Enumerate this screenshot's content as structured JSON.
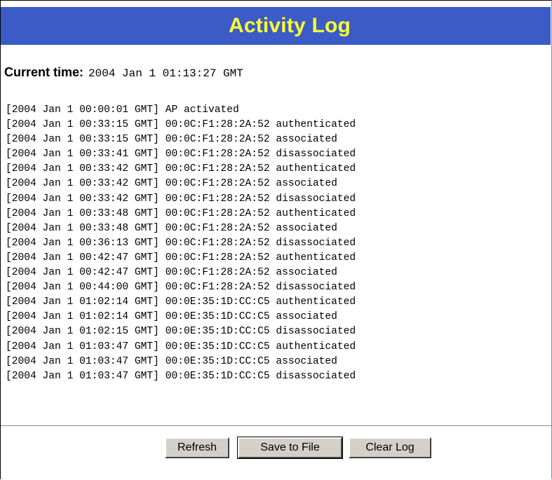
{
  "header": {
    "title": "Activity Log"
  },
  "current_time": {
    "label": "Current time:",
    "value": "2004 Jan 1 01:13:27 GMT"
  },
  "log": [
    "[2004 Jan 1 00:00:01 GMT] AP activated",
    "[2004 Jan 1 00:33:15 GMT] 00:0C:F1:28:2A:52 authenticated",
    "[2004 Jan 1 00:33:15 GMT] 00:0C:F1:28:2A:52 associated",
    "[2004 Jan 1 00:33:41 GMT] 00:0C:F1:28:2A:52 disassociated",
    "[2004 Jan 1 00:33:42 GMT] 00:0C:F1:28:2A:52 authenticated",
    "[2004 Jan 1 00:33:42 GMT] 00:0C:F1:28:2A:52 associated",
    "[2004 Jan 1 00:33:42 GMT] 00:0C:F1:28:2A:52 disassociated",
    "[2004 Jan 1 00:33:48 GMT] 00:0C:F1:28:2A:52 authenticated",
    "[2004 Jan 1 00:33:48 GMT] 00:0C:F1:28:2A:52 associated",
    "[2004 Jan 1 00:36:13 GMT] 00:0C:F1:28:2A:52 disassociated",
    "[2004 Jan 1 00:42:47 GMT] 00:0C:F1:28:2A:52 authenticated",
    "[2004 Jan 1 00:42:47 GMT] 00:0C:F1:28:2A:52 associated",
    "[2004 Jan 1 00:44:00 GMT] 00:0C:F1:28:2A:52 disassociated",
    "[2004 Jan 1 01:02:14 GMT] 00:0E:35:1D:CC:C5 authenticated",
    "[2004 Jan 1 01:02:14 GMT] 00:0E:35:1D:CC:C5 associated",
    "[2004 Jan 1 01:02:15 GMT] 00:0E:35:1D:CC:C5 disassociated",
    "[2004 Jan 1 01:03:47 GMT] 00:0E:35:1D:CC:C5 authenticated",
    "[2004 Jan 1 01:03:47 GMT] 00:0E:35:1D:CC:C5 associated",
    "[2004 Jan 1 01:03:47 GMT] 00:0E:35:1D:CC:C5 disassociated"
  ],
  "buttons": {
    "refresh": "Refresh",
    "save": "Save to File",
    "clear": "Clear Log"
  },
  "colors": {
    "header_bg": "#3b5bc7",
    "header_text": "#ffff33",
    "button_face": "#d4d0c8"
  }
}
